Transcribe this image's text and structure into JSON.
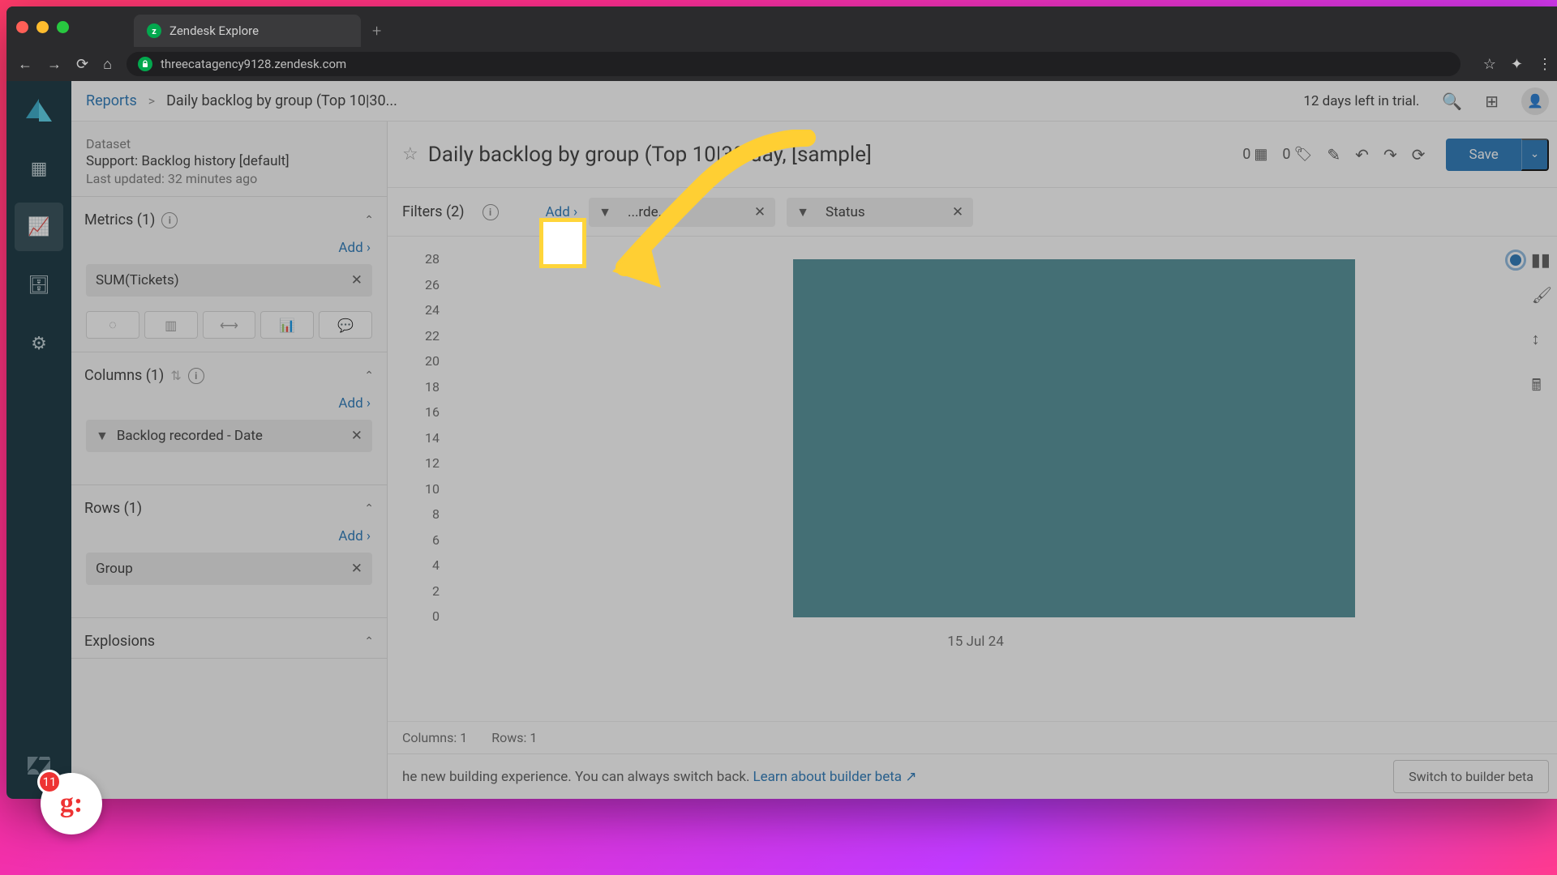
{
  "browser": {
    "tab_title": "Zendesk Explore",
    "url": "threecatagency9128.zendesk.com"
  },
  "breadcrumb": {
    "root": "Reports",
    "current": "Daily backlog by group (Top 10|30..."
  },
  "trial_text": "12 days left in trial.",
  "dataset": {
    "label": "Dataset",
    "name": "Support: Backlog history [default]",
    "updated": "Last updated: 32 minutes ago"
  },
  "sections": {
    "metrics": {
      "title": "Metrics (1)",
      "add": "Add ›"
    },
    "columns": {
      "title": "Columns (1)",
      "add": "Add ›"
    },
    "rows": {
      "title": "Rows (1)",
      "add": "Add ›"
    },
    "explosions": {
      "title": "Explosions"
    }
  },
  "metric_pill": "SUM(Tickets)",
  "column_pill": "Backlog recorded - Date",
  "row_pill": "Group",
  "report_title": "Daily backlog by group (Top 10|30 day, [sample]",
  "counts": {
    "panels": "0",
    "tags": "0"
  },
  "save_label": "Save",
  "filters": {
    "label": "Filters (2)",
    "add": "Add ›",
    "chip1": "...rde...",
    "chip2": "Status"
  },
  "footer": {
    "cols": "Columns: 1",
    "rows": "Rows: 1"
  },
  "bottom": {
    "text": "he new building experience. You can always switch back.",
    "link": "Learn about builder beta",
    "button": "Switch to builder beta"
  },
  "badge_count": "11",
  "chart_data": {
    "type": "bar",
    "categories": [
      "15 Jul 24"
    ],
    "values": [
      25
    ],
    "y_ticks": [
      28,
      26,
      24,
      22,
      20,
      18,
      16,
      14,
      12,
      10,
      8,
      6,
      4,
      2,
      0
    ],
    "ylim": [
      0,
      28
    ],
    "xlabel": "",
    "ylabel": ""
  }
}
